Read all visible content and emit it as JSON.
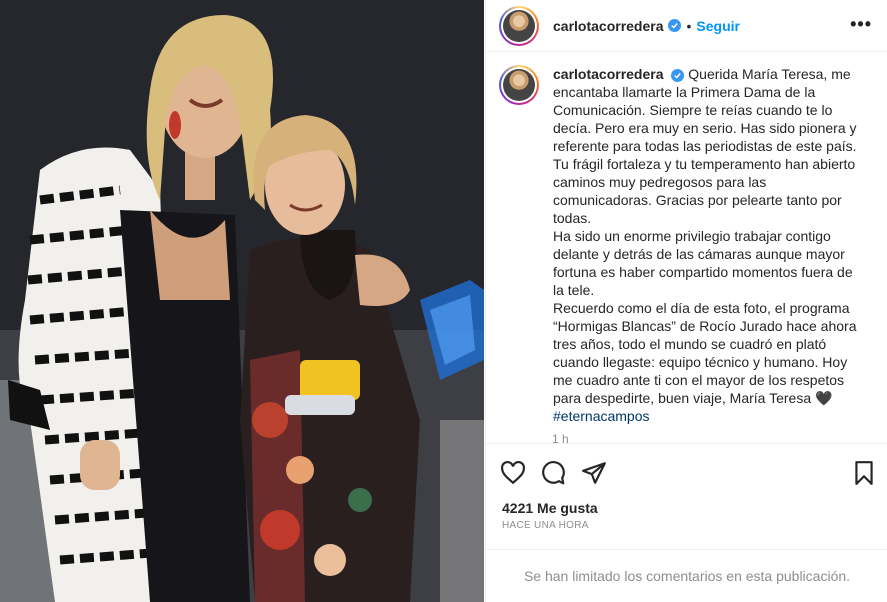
{
  "post": {
    "username": "carlotacorredera",
    "verified": true,
    "separator": "•",
    "follow_label": "Seguir",
    "more_label": "•••",
    "caption": "Querida María Teresa, me encantaba llamarte la Primera Dama de la Comunicación. Siempre te reías cuando te lo decía. Pero era muy en serio. Has sido pionera y referente para todas las periodistas de este país. Tu frágil fortaleza y tu temperamento han abierto caminos muy pedregosos para las comunicadoras. Gracias por pelearte tanto por todas.\nHa sido un enorme privilegio trabajar contigo delante y detrás de las cámaras aunque mayor fortuna es haber compartido momentos fuera de la tele.\nRecuerdo como el día de esta foto, el programa “Hormigas Blancas” de Rocío Jurado hace ahora tres años, todo el mundo se cuadró en plató cuando llegaste: equipo técnico y humano. Hoy me cuadro ante ti con el mayor de los respetos para despedirte, buen viaje, María Teresa 🖤",
    "hashtag": "#eternacampos",
    "caption_time": "1 h",
    "likes_text": "4221 Me gusta",
    "time_ago": "HACE UNA HORA",
    "comments_limited_text": "Se han limitado los comentarios en esta publicación."
  },
  "icons": {
    "like": "heart-icon",
    "comment": "comment-icon",
    "share": "share-icon",
    "save": "bookmark-icon",
    "verified": "verified-badge-icon"
  },
  "colors": {
    "link_blue": "#0095f6",
    "hashtag": "#00376b",
    "verified": "#3897f0",
    "muted": "#8e8e8e",
    "border": "#efefef"
  }
}
